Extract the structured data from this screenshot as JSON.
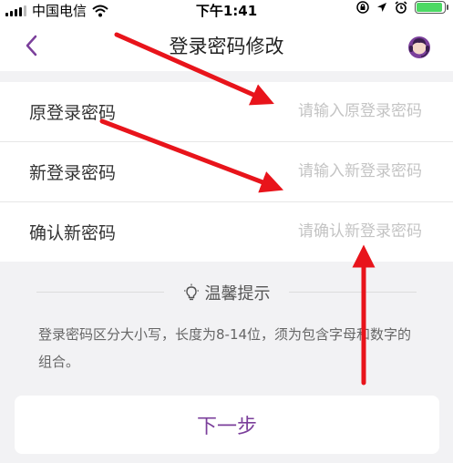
{
  "status_bar": {
    "carrier": "中国电信",
    "time": "下午1:41"
  },
  "nav": {
    "title": "登录密码修改"
  },
  "form": {
    "rows": [
      {
        "label": "原登录密码",
        "placeholder": "请输入原登录密码"
      },
      {
        "label": "新登录密码",
        "placeholder": "请输入新登录密码"
      },
      {
        "label": "确认新密码",
        "placeholder": "请确认新登录密码"
      }
    ]
  },
  "tips": {
    "title": "温馨提示",
    "text": "登录密码区分大小写，长度为8-14位，须为包含字母和数字的组合。"
  },
  "next_button": {
    "label": "下一步"
  },
  "colors": {
    "accent": "#7b3f9b",
    "annotation_arrow": "#e8141b",
    "battery": "#4cd964"
  },
  "icons": [
    "signal-icon",
    "wifi-icon",
    "lock-rotation-icon",
    "location-icon",
    "alarm-icon",
    "battery-icon",
    "back-chevron-icon",
    "customer-service-icon",
    "lightbulb-icon"
  ]
}
